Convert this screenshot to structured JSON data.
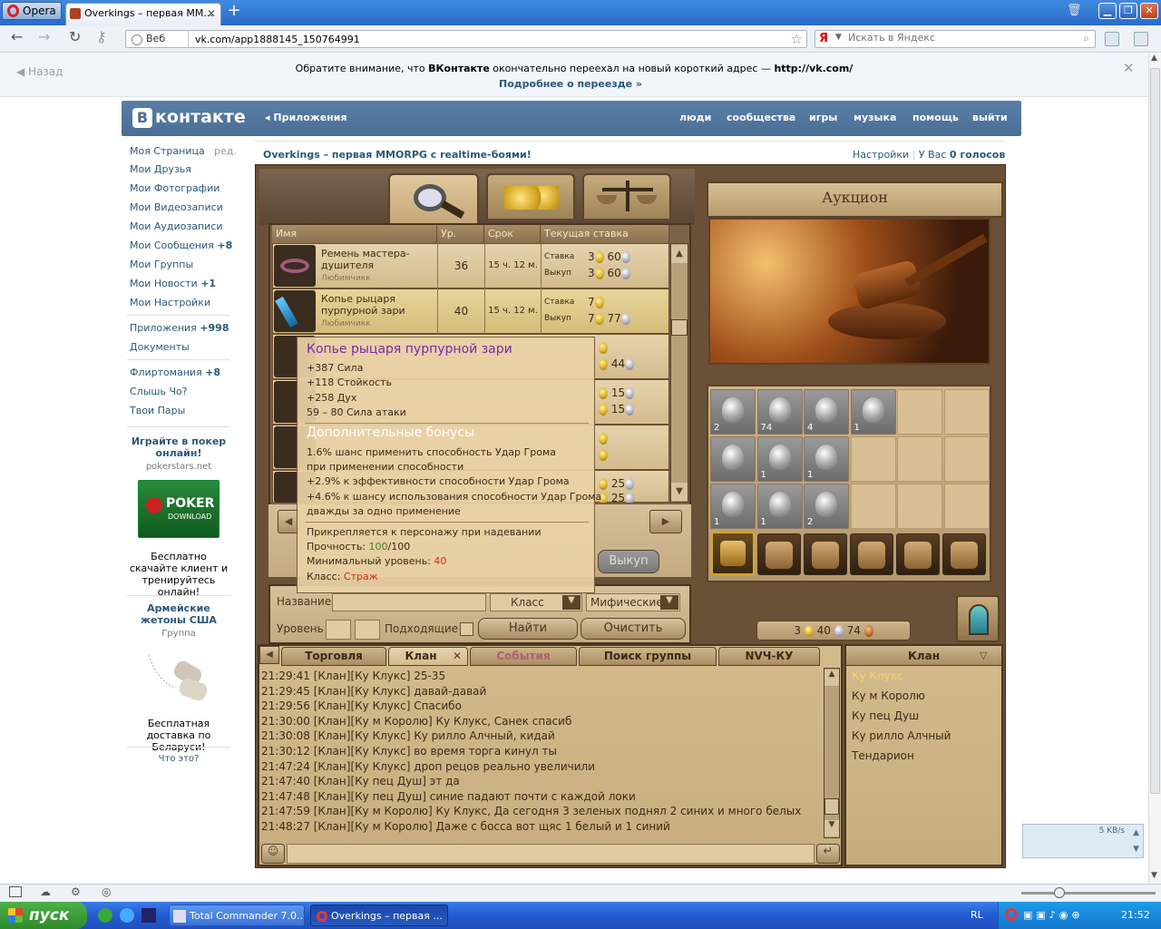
{
  "browser": {
    "opera_label": "Opera",
    "tab_title": "Overkings – первая ММ...",
    "url_prefix": "Веб",
    "url": "vk.com/app1888145_150764991",
    "search_placeholder": "Искать в Яндекс"
  },
  "notice": {
    "back": "Назад",
    "line1_a": "Обратите внимание, что ",
    "line1_b": "ВКонтакте",
    "line1_c": " окончательно переехал на новый короткий адрес — ",
    "line1_d": "http://vk.com/",
    "line2": "Подробнее о переезде »"
  },
  "vk": {
    "logo": "контакте",
    "apps": "Приложения",
    "nav": [
      "люди",
      "сообщества",
      "игры",
      "музыка",
      "помощь",
      "выйти"
    ],
    "sidebar": [
      {
        "label": "Моя Страница",
        "extra": "ред."
      },
      {
        "label": "Мои Друзья"
      },
      {
        "label": "Мои Фотографии"
      },
      {
        "label": "Мои Видеозаписи"
      },
      {
        "label": "Мои Аудиозаписи"
      },
      {
        "label": "Мои Сообщения",
        "badge": "+8"
      },
      {
        "label": "Мои Группы"
      },
      {
        "label": "Мои Новости",
        "badge": "+1"
      },
      {
        "label": "Мои Настройки"
      },
      {
        "label": "Приложения",
        "badge": "+998"
      },
      {
        "label": "Документы"
      },
      {
        "label": "Флиртомания",
        "badge": "+8"
      },
      {
        "label": "Слышь Чо?"
      },
      {
        "label": "Твои Пары"
      }
    ],
    "ad1": {
      "title": "Играйте в покер онлайн!",
      "domain": "pokerstars.net",
      "logo1": "POKER",
      "logo2": "DOWNLOAD",
      "text": "Бесплатно скачайте клиент и тренируйтесь онлайн!"
    },
    "ad2": {
      "title": "Армейские жетоны США",
      "sub": "Группа",
      "text": "Бесплатная доставка по Беларуси!"
    },
    "what": "Что это?",
    "app_title": "Overkings – первая MMORPG с realtime-боями!",
    "settings": "Настройки",
    "votes_prefix": "У Вас ",
    "votes": "0 голосов"
  },
  "game": {
    "auction_title": "Аукцион",
    "columns": [
      "Имя",
      "Ур.",
      "Срок",
      "Текущая ставка"
    ],
    "rows": [
      {
        "name": "Ремень мастера-душителя",
        "sub": "Любимчикк",
        "level": "36",
        "term": "15 ч. 12 м.",
        "bid_label": "Ставка",
        "bid_g": "3",
        "bid_s": "60",
        "buy_label": "Выкуп",
        "buy_g": "3",
        "buy_s": "60"
      },
      {
        "name": "Копье рыцаря пурпурной зари",
        "sub": "Любимчикк",
        "level": "40",
        "term": "15 ч. 12 м.",
        "bid_label": "Ставка",
        "bid_g": "7",
        "bid_s": "",
        "buy_label": "Выкуп",
        "buy_g": "7",
        "buy_s": "77"
      }
    ],
    "partial_rows": [
      {
        "a": "",
        "b": "44"
      },
      {
        "a": "15",
        "b": "15"
      },
      {
        "a": "",
        "b": ""
      },
      {
        "a": "25",
        "b": "25"
      }
    ],
    "buyout_btn": "Выкуп",
    "filter": {
      "name_label": "Название",
      "class_label": "Класс",
      "rarity": "Мифические",
      "level_label": "Уровень",
      "suitable_label": "Подходящие",
      "find_btn": "Найти",
      "clear_btn": "Очистить"
    },
    "inventory": [
      "2",
      "74",
      "4",
      "1",
      "",
      "",
      "",
      "1",
      "1",
      "",
      "",
      "",
      "1",
      "1",
      "2",
      "",
      "",
      ""
    ],
    "money": {
      "gold": "3",
      "silver": "40",
      "bronze": "74"
    },
    "tooltip": {
      "title": "Копье рыцаря пурпурной зари",
      "stats": [
        "+387 Сила",
        "+118 Стойкость",
        "+258 Дух",
        "59 – 80 Сила атаки"
      ],
      "bonus_title": "Дополнительные бонусы",
      "bonuses": [
        "1.6% шанс применить способность Удар Грома",
        "при применении способности",
        "+2.9% к эффективности способности Удар Грома",
        "+4.6% к шансу использования способности Удар Грома",
        "дважды за одно применение"
      ],
      "bind": "Прикрепляется к персонажу при надевании",
      "dur_label": "Прочность: ",
      "dur_cur": "100",
      "dur_max": "/100",
      "minlvl_label": "Минимальный уровень: ",
      "minlvl": "40",
      "class_label": "Класс: ",
      "class": "Страж"
    },
    "chat_tabs": [
      "Торговля",
      "Клан",
      "События",
      "Поиск группы",
      "NVЧ-КУ"
    ],
    "chat": [
      "21:29:41 [Клан][Ку Клукс] 25-35",
      "21:29:45 [Клан][Ку Клукс] давай-давай",
      "21:29:56 [Клан][Ку Клукс] Спасибо",
      "21:30:00 [Клан][Ку м Королю] Ку Клукс, Санек спасиб",
      "21:30:08 [Клан][Ку Клукс] Ку рилло Алчный, кидай",
      "21:30:12 [Клан][Ку Клукс] во время торга кинул ты",
      "21:47:24 [Клан][Ку Клукс] дроп рецов реально увеличили",
      "21:47:40 [Клан][Ку пец Душ] эт да",
      "21:47:48 [Клан][Ку пец Душ] синие падают почти с каждой локи",
      "21:47:59 [Клан][Ку м Королю] Ку Клукс, Да сегодня 3 зеленых поднял 2 синих и много белых",
      "21:48:27 [Клан][Ку м Королю] Даже с босса вот щяс 1 белый и 1 синий"
    ],
    "clan_title": "Клан",
    "clan_members": [
      "Ку Клукс",
      "Ку м Королю",
      "Ку пец Душ",
      "Ку рилло Алчный",
      "Тендарион"
    ]
  },
  "os": {
    "start": "пуск",
    "tasks": [
      "Total Commander 7.0...",
      "Overkings – первая ..."
    ],
    "lang": "RL",
    "clock": "21:52",
    "kbs": "5 KB/s"
  }
}
